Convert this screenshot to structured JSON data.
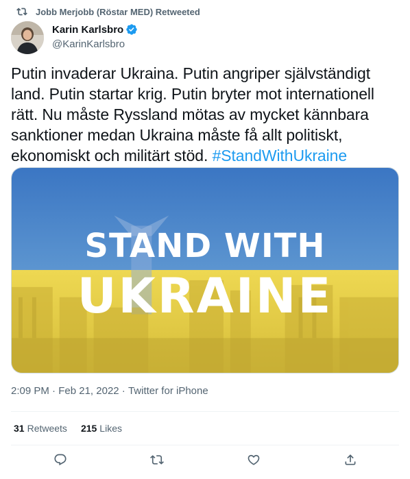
{
  "retweet_header": {
    "text": "Jobb Merjobb (Röstar MED) Retweeted",
    "icon": "retweet-icon"
  },
  "author": {
    "name": "Karin Karlsbro",
    "handle": "@KarinKarlsbro",
    "verified": true,
    "verified_icon": "verified-badge-icon"
  },
  "tweet": {
    "text": "Putin invaderar Ukraina. Putin angriper självständigt land. Putin startar krig. Putin bryter mot internationell rätt. Nu måste Ryssland mötas av mycket kännbara sanktioner medan Ukraina måste få allt politiskt, ekonomiskt och militärt stöd. ",
    "hashtag": "#StandWithUkraine"
  },
  "media": {
    "line1": "STAND WITH",
    "line2": "UKRAINE",
    "colors": {
      "blue": "#3a78c4",
      "yellow": "#e9d24a"
    }
  },
  "meta": {
    "time": "2:09 PM",
    "sep1": " · ",
    "date": "Feb 21, 2022",
    "sep2": " · ",
    "source": "Twitter for iPhone"
  },
  "stats": {
    "retweets_count": "31",
    "retweets_label": "Retweets",
    "likes_count": "215",
    "likes_label": "Likes"
  },
  "actions": {
    "reply_icon": "reply-icon",
    "retweet_icon": "retweet-icon",
    "like_icon": "heart-icon",
    "share_icon": "share-icon"
  },
  "colors": {
    "text_primary": "#0f1419",
    "text_secondary": "#536471",
    "link": "#1d9bf0"
  }
}
